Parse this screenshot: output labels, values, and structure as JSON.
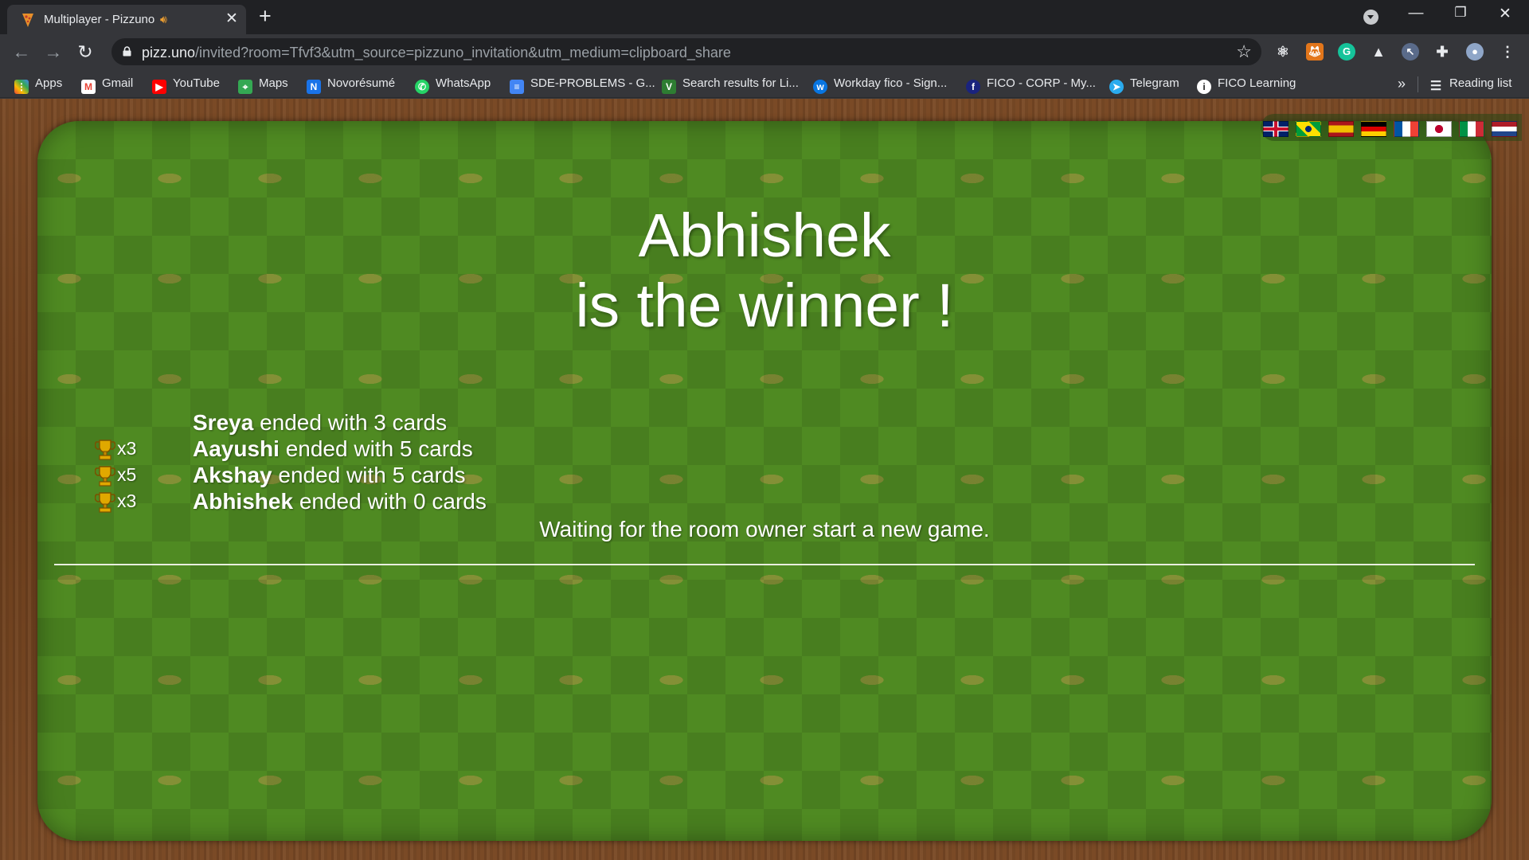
{
  "browser": {
    "tab": {
      "title": "Multiplayer - Pizzuno",
      "favicon": "pizza-icon",
      "audio": "speaker-icon"
    },
    "url": {
      "host": "pizz.uno",
      "path": "/invited?room=Tfvf3&utm_source=pizzuno_invitation&utm_medium=clipboard_share"
    },
    "bookmarks": [
      {
        "label": "Apps",
        "icon": "apps-grid-icon"
      },
      {
        "label": "Gmail",
        "icon": "gmail-icon"
      },
      {
        "label": "YouTube",
        "icon": "youtube-icon"
      },
      {
        "label": "Maps",
        "icon": "maps-icon"
      },
      {
        "label": "Novorésumé",
        "icon": "novoresume-icon"
      },
      {
        "label": "WhatsApp",
        "icon": "whatsapp-icon"
      },
      {
        "label": "SDE-PROBLEMS - G...",
        "icon": "docs-icon"
      },
      {
        "label": "Search results for Li...",
        "icon": "bookmark-v-icon"
      },
      {
        "label": "Workday fico - Sign...",
        "icon": "workday-icon"
      },
      {
        "label": "FICO - CORP - My...",
        "icon": "fico-icon"
      },
      {
        "label": "Telegram",
        "icon": "telegram-icon"
      },
      {
        "label": "FICO Learning",
        "icon": "fico-learning-icon"
      }
    ],
    "reading_list": "Reading list",
    "more": "»"
  },
  "game": {
    "winner_name": "Abhishek",
    "winner_text": "is the winner !",
    "results": [
      {
        "trophies": "",
        "name": "Sreya",
        "text": "ended with 3 cards"
      },
      {
        "trophies": "x3",
        "name": "Aayushi",
        "text": "ended with 5 cards"
      },
      {
        "trophies": "x5",
        "name": "Akshay",
        "text": "ended with 5 cards"
      },
      {
        "trophies": "x3",
        "name": "Abhishek",
        "text": "ended with 0 cards"
      }
    ],
    "waiting": "Waiting for the room owner start a new game.",
    "languages": [
      "en-gb",
      "pt-br",
      "es",
      "de",
      "fr",
      "ja",
      "it",
      "nl"
    ]
  },
  "colors": {
    "board_green": "#4f8a22",
    "wood": "#6b3e1c",
    "trophy": "#e0a800"
  }
}
